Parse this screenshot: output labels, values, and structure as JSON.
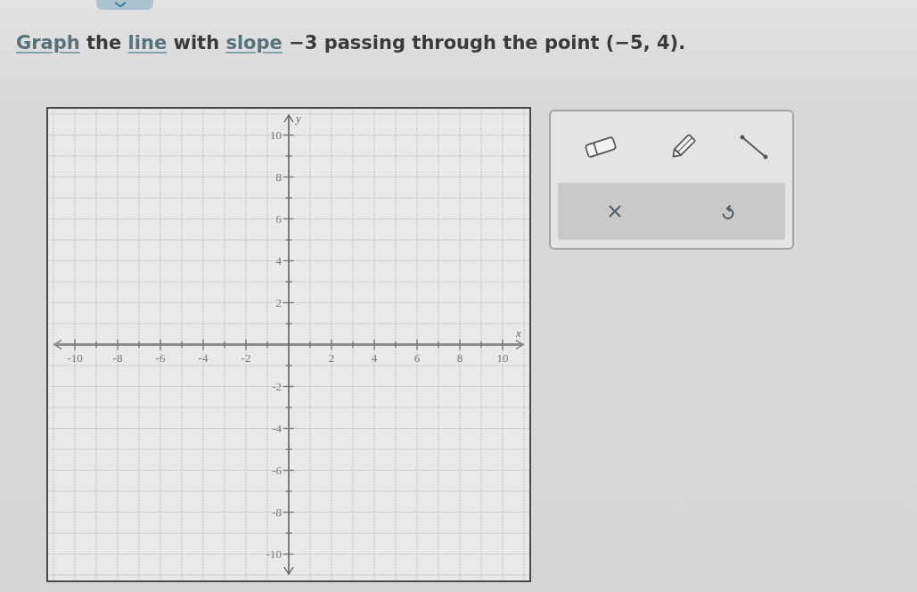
{
  "prompt": {
    "segments": [
      {
        "kind": "link",
        "text": "Graph"
      },
      {
        "kind": "text",
        "text": " the "
      },
      {
        "kind": "link",
        "text": "line"
      },
      {
        "kind": "text",
        "text": " with "
      },
      {
        "kind": "link",
        "text": "slope"
      },
      {
        "kind": "text",
        "text": " −3 passing through the point (−5, 4)."
      }
    ]
  },
  "graph": {
    "chart_data": {
      "type": "line",
      "xlabel": "x",
      "ylabel": "y",
      "xlim": [
        -11,
        11
      ],
      "ylim": [
        -11,
        11
      ],
      "xticks": [
        -10,
        -8,
        -6,
        -4,
        -2,
        2,
        4,
        6,
        8,
        10
      ],
      "yticks": [
        -10,
        -8,
        -6,
        -4,
        -2,
        2,
        4,
        6,
        8,
        10
      ],
      "grid": true
    }
  }
}
